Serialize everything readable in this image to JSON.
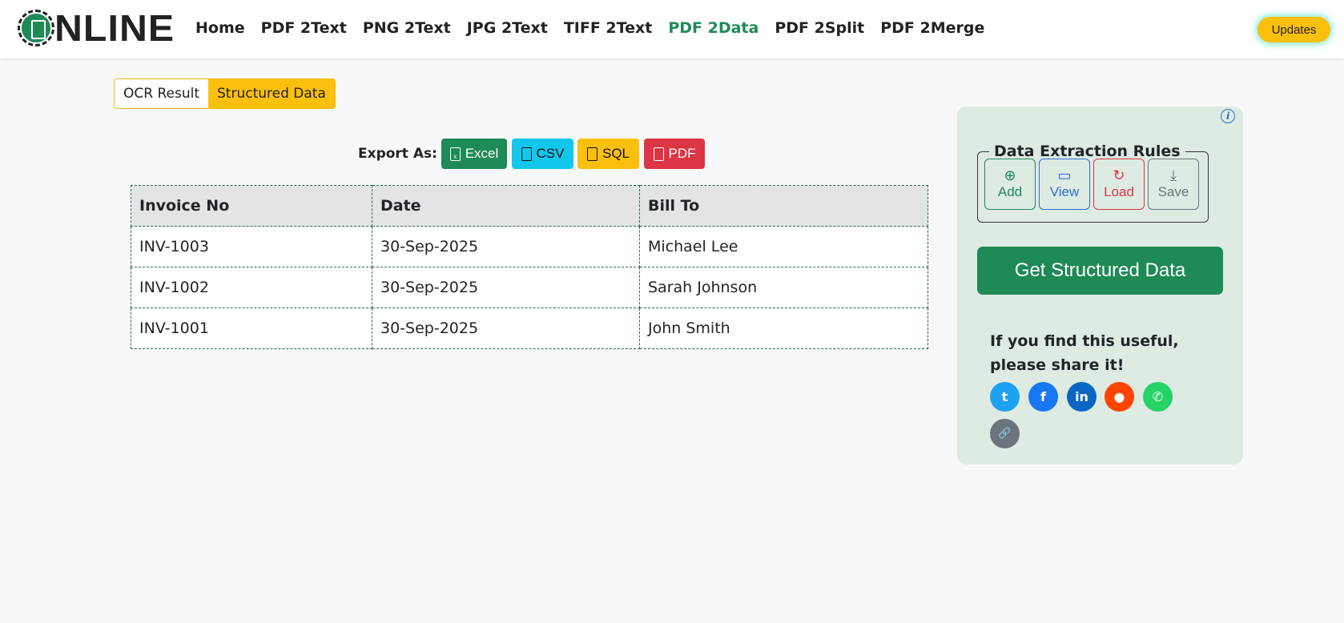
{
  "header": {
    "logo_text": "NLINE",
    "nav": [
      "Home",
      "PDF 2Text",
      "PNG 2Text",
      "JPG 2Text",
      "TIFF 2Text",
      "PDF 2Data",
      "PDF 2Split",
      "PDF 2Merge"
    ],
    "active_nav": "PDF 2Data",
    "updates_label": "Updates"
  },
  "tabs": [
    "OCR Result",
    "Structured Data"
  ],
  "export": {
    "label": "Export As:",
    "buttons": [
      {
        "label": "Excel",
        "icon": "X",
        "color": "#1e8a55",
        "text": "#fff"
      },
      {
        "label": "CSV",
        "icon": "csv",
        "color": "#12c6ec",
        "text": "#111"
      },
      {
        "label": "SQL",
        "icon": "sql",
        "color": "#fbbf0e",
        "text": "#111"
      },
      {
        "label": "PDF",
        "icon": "pdf",
        "color": "#dc3545",
        "text": "#fff"
      }
    ]
  },
  "table": {
    "headers": [
      "Invoice No",
      "Date",
      "Bill To"
    ],
    "rows": [
      [
        "INV-1003",
        "30-Sep-2025",
        "Michael Lee"
      ],
      [
        "INV-1002",
        "30-Sep-2025",
        "Sarah Johnson"
      ],
      [
        "INV-1001",
        "30-Sep-2025",
        "John Smith"
      ]
    ]
  },
  "panel": {
    "info_icon": "i",
    "rules_title": "Data Extraction Rules",
    "rules_buttons": [
      {
        "label": "Add",
        "glyph": "⊕",
        "color": "#1e8a55"
      },
      {
        "label": "View",
        "glyph": "▭",
        "color": "#2c6ed3"
      },
      {
        "label": "Load",
        "glyph": "↻",
        "color": "#dc3545"
      },
      {
        "label": "Save",
        "glyph": "⤓",
        "color": "#6c757d"
      }
    ],
    "get_button": "Get Structured Data",
    "share_text": "If you find this useful, please share it!",
    "social": [
      {
        "name": "twitter",
        "glyph": "t",
        "color": "#1da1f2"
      },
      {
        "name": "facebook",
        "glyph": "f",
        "color": "#1877f2"
      },
      {
        "name": "linkedin",
        "glyph": "in",
        "color": "#0a66c2"
      },
      {
        "name": "reddit",
        "glyph": "●",
        "color": "#ff4500"
      },
      {
        "name": "whatsapp",
        "glyph": "✆",
        "color": "#25d366"
      },
      {
        "name": "copy-link",
        "glyph": "🔗",
        "color": "#6c757d"
      }
    ]
  }
}
